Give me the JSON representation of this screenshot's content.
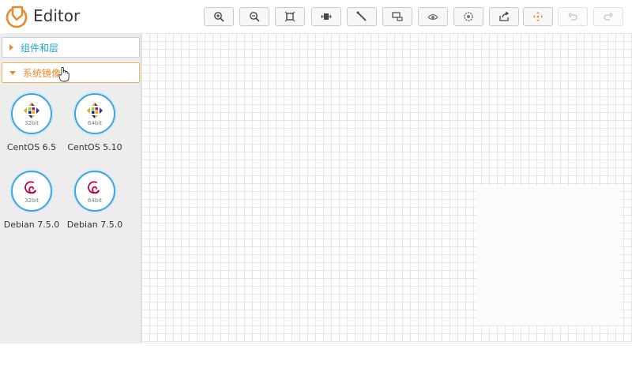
{
  "app": {
    "title": "Editor"
  },
  "toolbar": {
    "buttons": [
      {
        "icon": "zoom-in-icon",
        "enabled": true
      },
      {
        "icon": "zoom-out-icon",
        "enabled": true
      },
      {
        "icon": "fit-screen-icon",
        "enabled": true
      },
      {
        "icon": "actual-size-icon",
        "enabled": true
      },
      {
        "icon": "connector-icon",
        "enabled": true
      },
      {
        "icon": "outline-icon",
        "enabled": true
      },
      {
        "icon": "visibility-icon",
        "enabled": true
      },
      {
        "icon": "settings-icon",
        "enabled": true
      },
      {
        "icon": "export-icon",
        "enabled": true
      },
      {
        "icon": "move-icon",
        "enabled": true
      },
      {
        "icon": "undo-icon",
        "enabled": false
      },
      {
        "icon": "redo-icon",
        "enabled": false
      }
    ]
  },
  "sidebar": {
    "panels": [
      {
        "label": "组件和层",
        "expanded": false
      },
      {
        "label": "系统镜像",
        "expanded": true
      }
    ],
    "images": [
      {
        "name": "CentOS 6.5",
        "bits": "32bit",
        "logo": "centos-icon"
      },
      {
        "name": "CentOS 5.10",
        "bits": "64bit",
        "logo": "centos-icon"
      },
      {
        "name": "Debian 7.5.0",
        "bits": "32bit",
        "logo": "debian-icon"
      },
      {
        "name": "Debian 7.5.0",
        "bits": "64bit",
        "logo": "debian-icon"
      }
    ]
  },
  "colors": {
    "accent": "#e8892c",
    "link": "#1a9fc0",
    "ring": "#3aa3e0"
  }
}
